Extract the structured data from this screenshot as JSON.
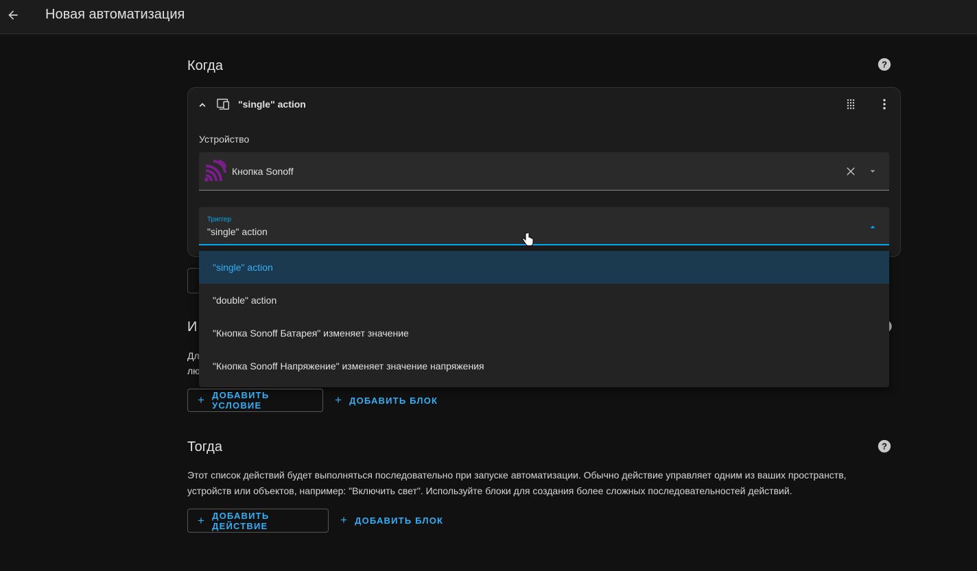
{
  "header": {
    "title": "Новая автоматизация"
  },
  "when": {
    "title": "Когда",
    "trigger_card": {
      "title": "\"single\" action",
      "device_label": "Устройство",
      "device_value": "Кнопка Sonoff",
      "trigger_label": "Триггер",
      "trigger_value": "\"single\" action",
      "options": [
        "\"single\" action",
        "\"double\" action",
        "\"Кнопка Sonoff Батарея\" изменяет значение",
        "\"Кнопка Sonoff Напряжение\" изменяет значение напряжения"
      ]
    }
  },
  "conditions": {
    "title_partial": "И",
    "desc_partial_1": "Дл",
    "desc_partial_2": "лю",
    "add_condition": "ДОБАВИТЬ УСЛОВИЕ",
    "add_block": "ДОБАВИТЬ БЛОК"
  },
  "then": {
    "title": "Тогда",
    "description_1": "Этот список действий будет выполняться последовательно при запуске автоматизации. Обычно действие управляет одним из ваших пространств,",
    "description_2": "устройств или объектов, например: \"Включить свет\". Используйте блоки для создания более сложных последовательностей действий.",
    "add_action": "ДОБАВИТЬ ДЕЙСТВИЕ",
    "add_block": "ДОБАВИТЬ БЛОК"
  },
  "colors": {
    "accent": "#03a9f4",
    "background": "#111111",
    "card": "#1c1c1c",
    "selected": "#1b3a4f",
    "device_icon": "#7a1f8a"
  },
  "icons": [
    "arrow-left-icon",
    "help-circle-icon",
    "chevron-up-icon",
    "device-icon",
    "drag-handle-icon",
    "dots-vertical-icon",
    "close-icon",
    "menu-down-icon",
    "menu-up-icon",
    "plus-icon",
    "cursor-hand-icon"
  ]
}
